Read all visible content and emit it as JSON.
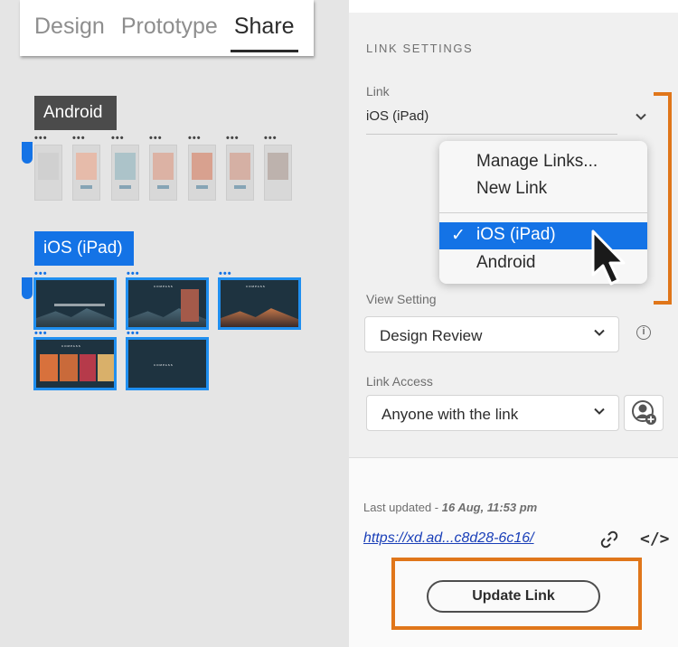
{
  "tabs": [
    {
      "label": "Design"
    },
    {
      "label": "Prototype"
    },
    {
      "label": "Share",
      "active": true
    }
  ],
  "canvas": {
    "android_label": "Android",
    "ios_label": "iOS (iPad)",
    "dots": "•••"
  },
  "panel": {
    "section_title": "LINK SETTINGS",
    "link_label": "Link",
    "link_value": "iOS (iPad)",
    "view_setting_label": "View Setting",
    "view_setting_value": "Design Review",
    "link_access_label": "Link Access",
    "link_access_value": "Anyone with the link",
    "last_updated_prefix": "Last updated - ",
    "last_updated_value": "16 Aug, 11:53 pm",
    "url": "https://xd.ad...c8d28-6c16/",
    "update_button": "Update Link"
  },
  "dropdown": {
    "items": [
      "Manage Links...",
      "New Link"
    ],
    "selected": "iOS (iPad)",
    "other": "Android",
    "check": "✓"
  },
  "icons": {
    "chevron": "chevron-down-icon",
    "info": "info-icon",
    "avatar": "add-user-icon",
    "link": "link-icon",
    "code": "embed-code-icon"
  },
  "colors": {
    "accent_blue": "#1473e6",
    "highlight_orange": "#e0761a",
    "url_blue": "#1a3fb8"
  }
}
